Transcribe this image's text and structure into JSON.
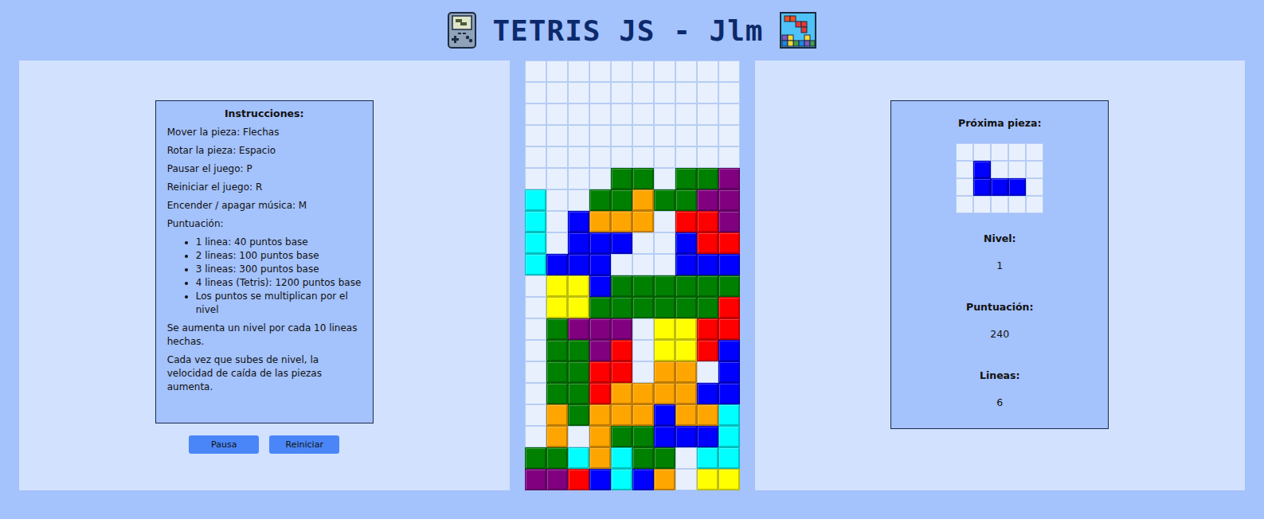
{
  "window": {
    "title": "TETRIS JS - Jlm"
  },
  "instructions": {
    "heading": "Instrucciones:",
    "lines": [
      "Mover la pieza: Flechas",
      "Rotar la pieza: Espacio",
      "Pausar el juego: P",
      "Reiniciar el juego: R",
      "Encender / apagar música: M"
    ],
    "scoring_label": "Puntuación:",
    "scoring": [
      "1 linea: 40 puntos base",
      "2 lineas: 100 puntos base",
      "3 lineas: 300 puntos base",
      "4 lineas (Tetris): 1200 puntos base",
      "Los puntos se multiplican por el nivel"
    ],
    "notes": [
      "Se aumenta un nivel por cada 10 lineas hechas.",
      "Cada vez que subes de nivel, la velocidad de caída de las piezas aumenta."
    ]
  },
  "buttons": [
    "Pausa",
    "Reiniciar"
  ],
  "palette": {
    "C": "#00ffff",
    "B": "#0000ff",
    "O": "#ffa500",
    "Y": "#ffff00",
    "G": "#008000",
    "P": "#800080",
    "R": "#ff0000"
  },
  "board": {
    "rows": [
      "..........",
      "..........",
      "..........",
      "..........",
      "..........",
      "....GG.GGP",
      "C..GGOGGPP",
      "C.BOOO.RRP",
      "C.BBB..BRR",
      "CBBB...BBB",
      ".YYBGGGGGG",
      ".YYGGGGGGR",
      ".GPPP.YYRR",
      ".GGPR.YYRB",
      ".GGRR.OO.B",
      ".GGROOOOBB",
      ".OGOOOBOOC",
      ".O.OGGBBBC",
      "GGCOCGG.CC",
      "PPRBCBO.YY"
    ]
  },
  "next_piece": {
    "label": "Próxima pieza:",
    "rows": [
      ".....",
      ".B...",
      ".BBB.",
      "....."
    ]
  },
  "stats": [
    {
      "label": "Nivel:",
      "value": "1"
    },
    {
      "label": "Puntuación:",
      "value": "240"
    },
    {
      "label": "Lineas:",
      "value": "6"
    }
  ]
}
